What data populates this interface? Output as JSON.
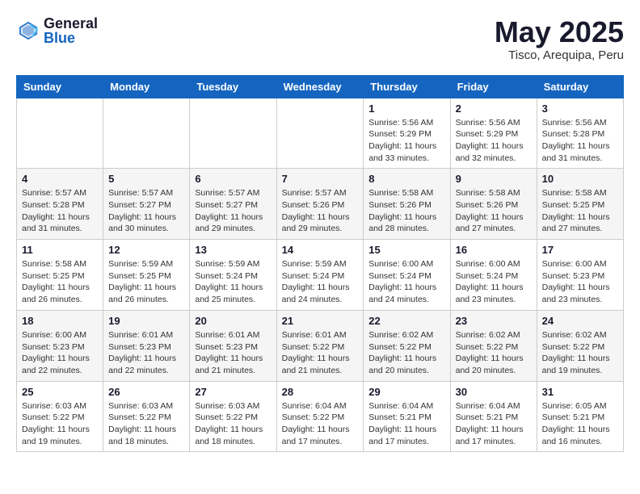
{
  "header": {
    "logo_general": "General",
    "logo_blue": "Blue",
    "month_title": "May 2025",
    "subtitle": "Tisco, Arequipa, Peru"
  },
  "days_of_week": [
    "Sunday",
    "Monday",
    "Tuesday",
    "Wednesday",
    "Thursday",
    "Friday",
    "Saturday"
  ],
  "weeks": [
    [
      {
        "day": "",
        "info": ""
      },
      {
        "day": "",
        "info": ""
      },
      {
        "day": "",
        "info": ""
      },
      {
        "day": "",
        "info": ""
      },
      {
        "day": "1",
        "info": "Sunrise: 5:56 AM\nSunset: 5:29 PM\nDaylight: 11 hours\nand 33 minutes."
      },
      {
        "day": "2",
        "info": "Sunrise: 5:56 AM\nSunset: 5:29 PM\nDaylight: 11 hours\nand 32 minutes."
      },
      {
        "day": "3",
        "info": "Sunrise: 5:56 AM\nSunset: 5:28 PM\nDaylight: 11 hours\nand 31 minutes."
      }
    ],
    [
      {
        "day": "4",
        "info": "Sunrise: 5:57 AM\nSunset: 5:28 PM\nDaylight: 11 hours\nand 31 minutes."
      },
      {
        "day": "5",
        "info": "Sunrise: 5:57 AM\nSunset: 5:27 PM\nDaylight: 11 hours\nand 30 minutes."
      },
      {
        "day": "6",
        "info": "Sunrise: 5:57 AM\nSunset: 5:27 PM\nDaylight: 11 hours\nand 29 minutes."
      },
      {
        "day": "7",
        "info": "Sunrise: 5:57 AM\nSunset: 5:26 PM\nDaylight: 11 hours\nand 29 minutes."
      },
      {
        "day": "8",
        "info": "Sunrise: 5:58 AM\nSunset: 5:26 PM\nDaylight: 11 hours\nand 28 minutes."
      },
      {
        "day": "9",
        "info": "Sunrise: 5:58 AM\nSunset: 5:26 PM\nDaylight: 11 hours\nand 27 minutes."
      },
      {
        "day": "10",
        "info": "Sunrise: 5:58 AM\nSunset: 5:25 PM\nDaylight: 11 hours\nand 27 minutes."
      }
    ],
    [
      {
        "day": "11",
        "info": "Sunrise: 5:58 AM\nSunset: 5:25 PM\nDaylight: 11 hours\nand 26 minutes."
      },
      {
        "day": "12",
        "info": "Sunrise: 5:59 AM\nSunset: 5:25 PM\nDaylight: 11 hours\nand 26 minutes."
      },
      {
        "day": "13",
        "info": "Sunrise: 5:59 AM\nSunset: 5:24 PM\nDaylight: 11 hours\nand 25 minutes."
      },
      {
        "day": "14",
        "info": "Sunrise: 5:59 AM\nSunset: 5:24 PM\nDaylight: 11 hours\nand 24 minutes."
      },
      {
        "day": "15",
        "info": "Sunrise: 6:00 AM\nSunset: 5:24 PM\nDaylight: 11 hours\nand 24 minutes."
      },
      {
        "day": "16",
        "info": "Sunrise: 6:00 AM\nSunset: 5:24 PM\nDaylight: 11 hours\nand 23 minutes."
      },
      {
        "day": "17",
        "info": "Sunrise: 6:00 AM\nSunset: 5:23 PM\nDaylight: 11 hours\nand 23 minutes."
      }
    ],
    [
      {
        "day": "18",
        "info": "Sunrise: 6:00 AM\nSunset: 5:23 PM\nDaylight: 11 hours\nand 22 minutes."
      },
      {
        "day": "19",
        "info": "Sunrise: 6:01 AM\nSunset: 5:23 PM\nDaylight: 11 hours\nand 22 minutes."
      },
      {
        "day": "20",
        "info": "Sunrise: 6:01 AM\nSunset: 5:23 PM\nDaylight: 11 hours\nand 21 minutes."
      },
      {
        "day": "21",
        "info": "Sunrise: 6:01 AM\nSunset: 5:22 PM\nDaylight: 11 hours\nand 21 minutes."
      },
      {
        "day": "22",
        "info": "Sunrise: 6:02 AM\nSunset: 5:22 PM\nDaylight: 11 hours\nand 20 minutes."
      },
      {
        "day": "23",
        "info": "Sunrise: 6:02 AM\nSunset: 5:22 PM\nDaylight: 11 hours\nand 20 minutes."
      },
      {
        "day": "24",
        "info": "Sunrise: 6:02 AM\nSunset: 5:22 PM\nDaylight: 11 hours\nand 19 minutes."
      }
    ],
    [
      {
        "day": "25",
        "info": "Sunrise: 6:03 AM\nSunset: 5:22 PM\nDaylight: 11 hours\nand 19 minutes."
      },
      {
        "day": "26",
        "info": "Sunrise: 6:03 AM\nSunset: 5:22 PM\nDaylight: 11 hours\nand 18 minutes."
      },
      {
        "day": "27",
        "info": "Sunrise: 6:03 AM\nSunset: 5:22 PM\nDaylight: 11 hours\nand 18 minutes."
      },
      {
        "day": "28",
        "info": "Sunrise: 6:04 AM\nSunset: 5:22 PM\nDaylight: 11 hours\nand 17 minutes."
      },
      {
        "day": "29",
        "info": "Sunrise: 6:04 AM\nSunset: 5:21 PM\nDaylight: 11 hours\nand 17 minutes."
      },
      {
        "day": "30",
        "info": "Sunrise: 6:04 AM\nSunset: 5:21 PM\nDaylight: 11 hours\nand 17 minutes."
      },
      {
        "day": "31",
        "info": "Sunrise: 6:05 AM\nSunset: 5:21 PM\nDaylight: 11 hours\nand 16 minutes."
      }
    ]
  ]
}
